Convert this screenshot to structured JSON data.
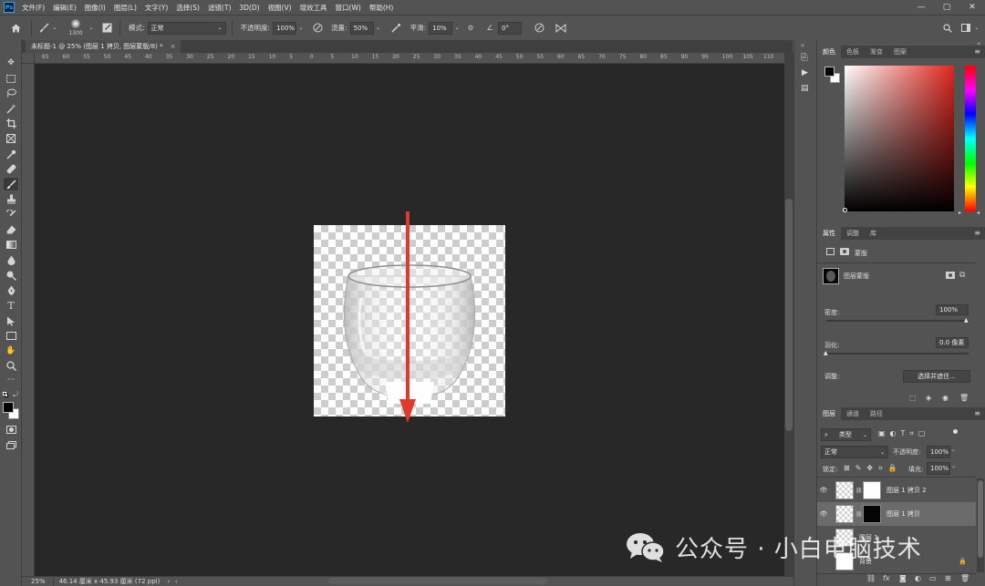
{
  "app": {
    "logo": "Ps"
  },
  "menu": [
    "文件(F)",
    "编辑(E)",
    "图像(I)",
    "图层(L)",
    "文字(Y)",
    "选择(S)",
    "滤镜(T)",
    "3D(D)",
    "视图(V)",
    "增效工具",
    "窗口(W)",
    "帮助(H)"
  ],
  "window_controls": [
    "—",
    "▢",
    "✕"
  ],
  "options": {
    "brush_size": "1300",
    "mode_label": "模式:",
    "mode_value": "正常",
    "opacity_label": "不透明度:",
    "opacity_value": "100%",
    "flow_label": "流量:",
    "flow_value": "50%",
    "smoothing_label": "平滑:",
    "smoothing_value": "10%",
    "angle_value": "0°"
  },
  "document": {
    "tab_title": "未标题-1 @ 25% (图层 1 拷贝, 图层蒙版/8) *",
    "tab_close": "×",
    "zoom": "25%",
    "doc_info": "46.14 厘米 x 45.93 厘米 (72 ppi)",
    "status_arrow": "›"
  },
  "ruler_ticks": [
    "65",
    "60",
    "55",
    "50",
    "45",
    "40",
    "35",
    "30",
    "25",
    "20",
    "15",
    "10",
    "5",
    "0",
    "5",
    "10",
    "15",
    "20",
    "25",
    "30",
    "35",
    "40",
    "45",
    "50",
    "55",
    "60",
    "65",
    "70",
    "75",
    "80",
    "85",
    "90",
    "95",
    "100",
    "105",
    "110"
  ],
  "color_panel": {
    "tabs": [
      "颜色",
      "色板",
      "渐变",
      "图案"
    ]
  },
  "properties_panel": {
    "tabs": [
      "属性",
      "调整",
      "库"
    ],
    "section_label": "蒙版",
    "mask_label": "图层蒙版",
    "density_label": "密度:",
    "density_value": "100%",
    "feather_label": "羽化:",
    "feather_value": "0.0 像素",
    "adjust_label": "调整:",
    "select_mask_button": "选择并遮住..."
  },
  "layers_panel": {
    "tabs": [
      "图层",
      "通道",
      "路径"
    ],
    "filter_value": "类型",
    "blend_mode": "正常",
    "opacity_label": "不透明度:",
    "opacity_value": "100%",
    "lock_label": "锁定:",
    "fill_label": "填充:",
    "fill_value": "100%",
    "layers": [
      {
        "name": "图层 1 拷贝 2",
        "visible": true,
        "mask": "white",
        "selected": false
      },
      {
        "name": "图层 1 拷贝",
        "visible": true,
        "mask": "black",
        "selected": true
      },
      {
        "name": "图层 1",
        "visible": false,
        "mask": "none",
        "selected": false
      },
      {
        "name": "背景",
        "visible": false,
        "mask": "none",
        "selected": false
      }
    ]
  },
  "watermark": {
    "text": "公众号 · 小白电脑技术"
  },
  "colors": {
    "arrow": "#e03a2b",
    "foreground": "#000000",
    "background": "#ffffff"
  }
}
